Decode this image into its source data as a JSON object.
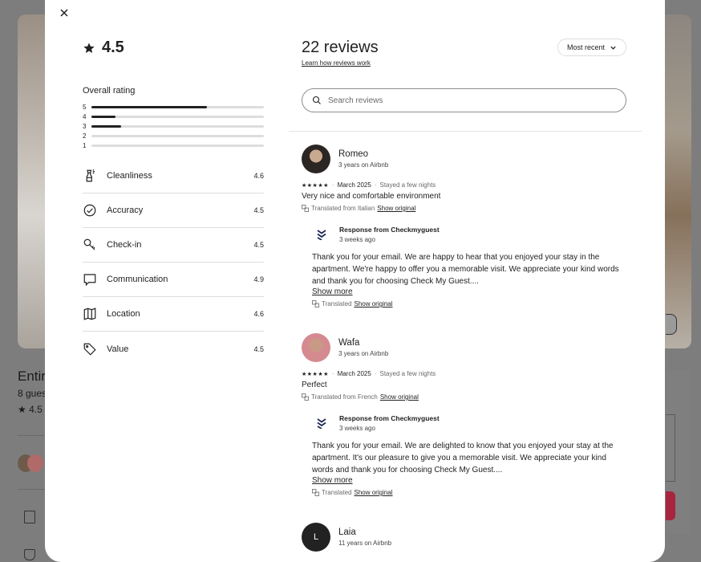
{
  "background": {
    "title": "Entir",
    "guests": "8 gues",
    "rating": "4.5"
  },
  "modal": {
    "score": "4.5",
    "overall_label": "Overall rating",
    "rating_bars": [
      {
        "label": "5",
        "fraction": 0.67
      },
      {
        "label": "4",
        "fraction": 0.14
      },
      {
        "label": "3",
        "fraction": 0.17
      },
      {
        "label": "2",
        "fraction": 0.0
      },
      {
        "label": "1",
        "fraction": 0.0
      }
    ],
    "categories": [
      {
        "label": "Cleanliness",
        "score": "4.6",
        "icon": "spray-bottle-icon"
      },
      {
        "label": "Accuracy",
        "score": "4.5",
        "icon": "check-circle-icon"
      },
      {
        "label": "Check-in",
        "score": "4.5",
        "icon": "key-icon"
      },
      {
        "label": "Communication",
        "score": "4.9",
        "icon": "message-icon"
      },
      {
        "label": "Location",
        "score": "4.6",
        "icon": "map-icon"
      },
      {
        "label": "Value",
        "score": "4.5",
        "icon": "tag-icon"
      }
    ],
    "reviews_title": "22 reviews",
    "learn_link": "Learn how reviews work",
    "sort_label": "Most recent",
    "search_placeholder": "Search reviews",
    "reviews": [
      {
        "name": "Romeo",
        "tenure": "3 years on Airbnb",
        "stars": "★★★★★",
        "date": "March 2025",
        "stay": "Stayed a few nights",
        "text": "Very nice and comfortable environment",
        "translated": "Translated from Italian",
        "show_original": "Show original",
        "response": {
          "title": "Response from Checkmyguest",
          "time": "3 weeks ago",
          "text": "Thank you for your email. We are happy to hear that you enjoyed your stay in the apartment. We're happy to offer you a memorable visit. We appreciate your kind words and thank you for choosing Check My Guest....",
          "show_more": "Show more",
          "translated": "Translated",
          "show_original": "Show original"
        }
      },
      {
        "name": "Wafa",
        "tenure": "3 years on Airbnb",
        "stars": "★★★★★",
        "date": "March 2025",
        "stay": "Stayed a few nights",
        "text": "Perfect",
        "translated": "Translated from French",
        "show_original": "Show original",
        "response": {
          "title": "Response from Checkmyguest",
          "time": "3 weeks ago",
          "text": "Thank you for your email. We are delighted to know that you enjoyed your stay at the apartment. It's our pleasure to give you a memorable visit. We appreciate your kind words and thank you for choosing Check My Guest....",
          "show_more": "Show more",
          "translated": "Translated",
          "show_original": "Show original"
        }
      },
      {
        "name": "Laia",
        "initial": "L",
        "tenure": "11 years on Airbnb"
      }
    ]
  }
}
